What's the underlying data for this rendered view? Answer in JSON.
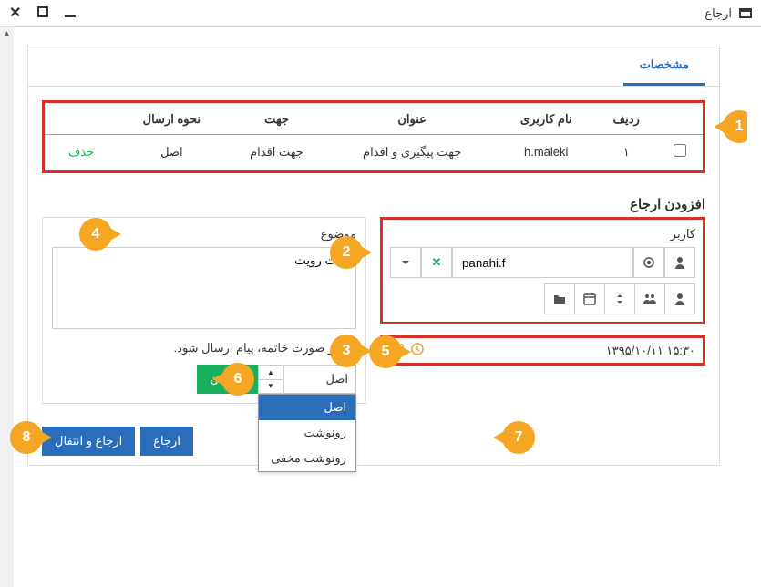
{
  "window": {
    "title": "ارجاع"
  },
  "tab": {
    "label": "مشخصات"
  },
  "table": {
    "headers": {
      "row": "ردیف",
      "username": "نام کاربری",
      "title": "عنوان",
      "direction": "جهت",
      "sendType": "نحوه ارسال",
      "action": ""
    },
    "rows": [
      {
        "row": "۱",
        "username": "h.maleki",
        "title": "جهت پیگیری و اقدام",
        "direction": "جهت اقدام",
        "sendType": "اصل",
        "action": "حذف"
      }
    ]
  },
  "section": {
    "title": "افزودن ارجاع"
  },
  "user": {
    "label": "کاربر",
    "value": "panahi.f"
  },
  "datetime": {
    "text": "۱۳۹۵/۱۰/۱۱   ۱۵:۳۰"
  },
  "subject": {
    "label": "موضوع",
    "value": "جهت رویت"
  },
  "checkbox": {
    "label": "در صورت خاتمه، پیام ارسال شود."
  },
  "sendtype": {
    "selected": "اصل",
    "options": [
      "اصل",
      "رونوشت",
      "رونوشت مخفی"
    ]
  },
  "buttons": {
    "add": "افزودن",
    "refer": "ارجاع",
    "referTransfer": "ارجاع و انتقال"
  },
  "callouts": {
    "c1": "1",
    "c2": "2",
    "c3": "3",
    "c4": "4",
    "c5": "5",
    "c6": "6",
    "c7": "7",
    "c8": "8"
  }
}
